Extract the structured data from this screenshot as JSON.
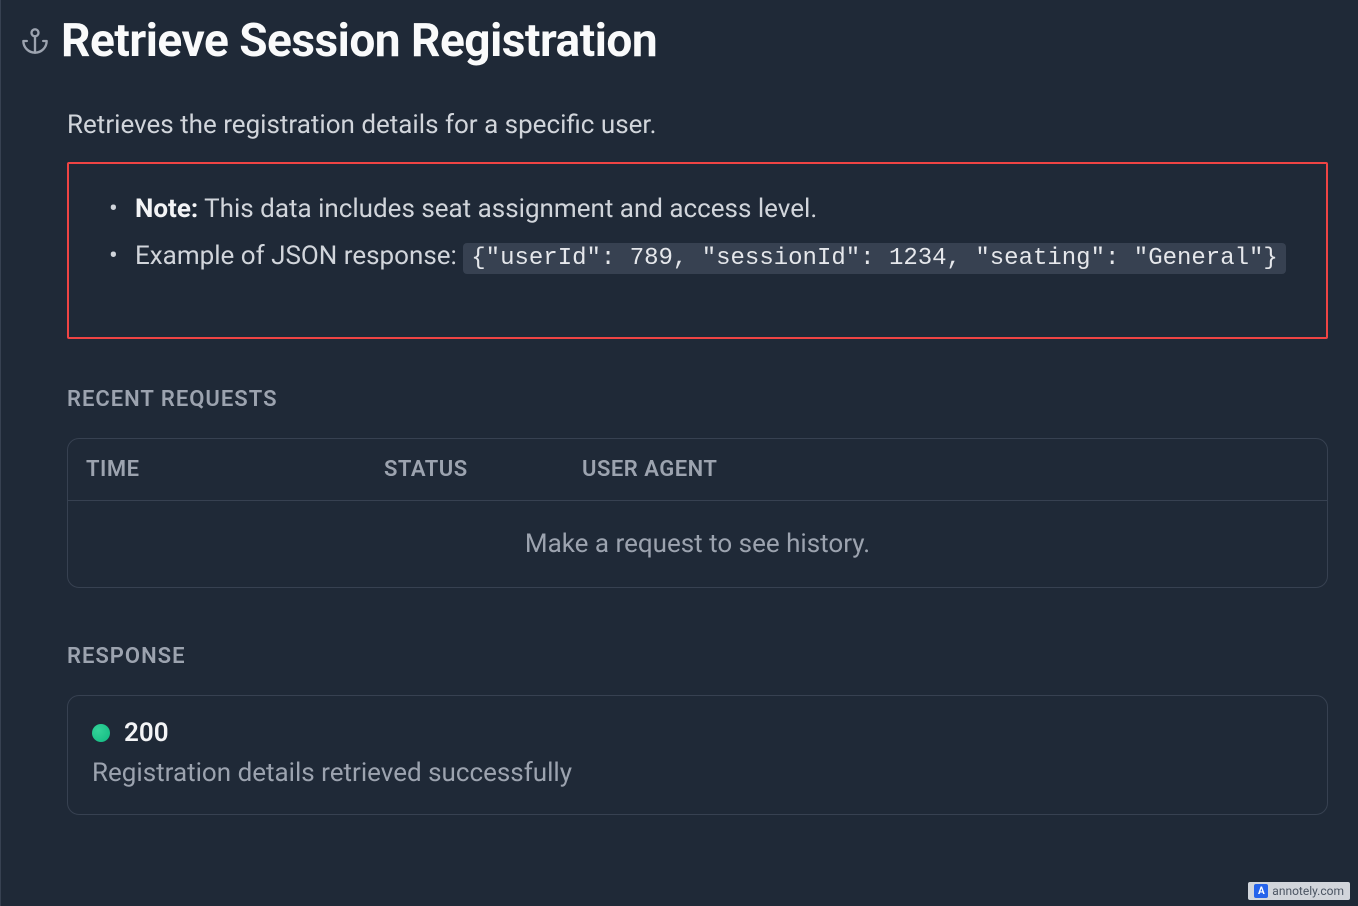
{
  "page": {
    "title": "Retrieve Session Registration",
    "description": "Retrieves the registration details for a specific user."
  },
  "note": {
    "heading": "Note:",
    "text": "This data includes seat assignment and access level.",
    "example_label": "Example of JSON response: ",
    "example_code": "{\"userId\": 789, \"sessionId\": 1234, \"seating\": \"General\"}"
  },
  "recent_requests": {
    "heading": "RECENT REQUESTS",
    "columns": {
      "time": "TIME",
      "status": "STATUS",
      "user_agent": "USER AGENT"
    },
    "empty_message": "Make a request to see history."
  },
  "response": {
    "heading": "RESPONSE",
    "status_code": "200",
    "message": "Registration details retrieved successfully"
  },
  "watermark": {
    "badge": "A",
    "text": "annotely.com"
  }
}
